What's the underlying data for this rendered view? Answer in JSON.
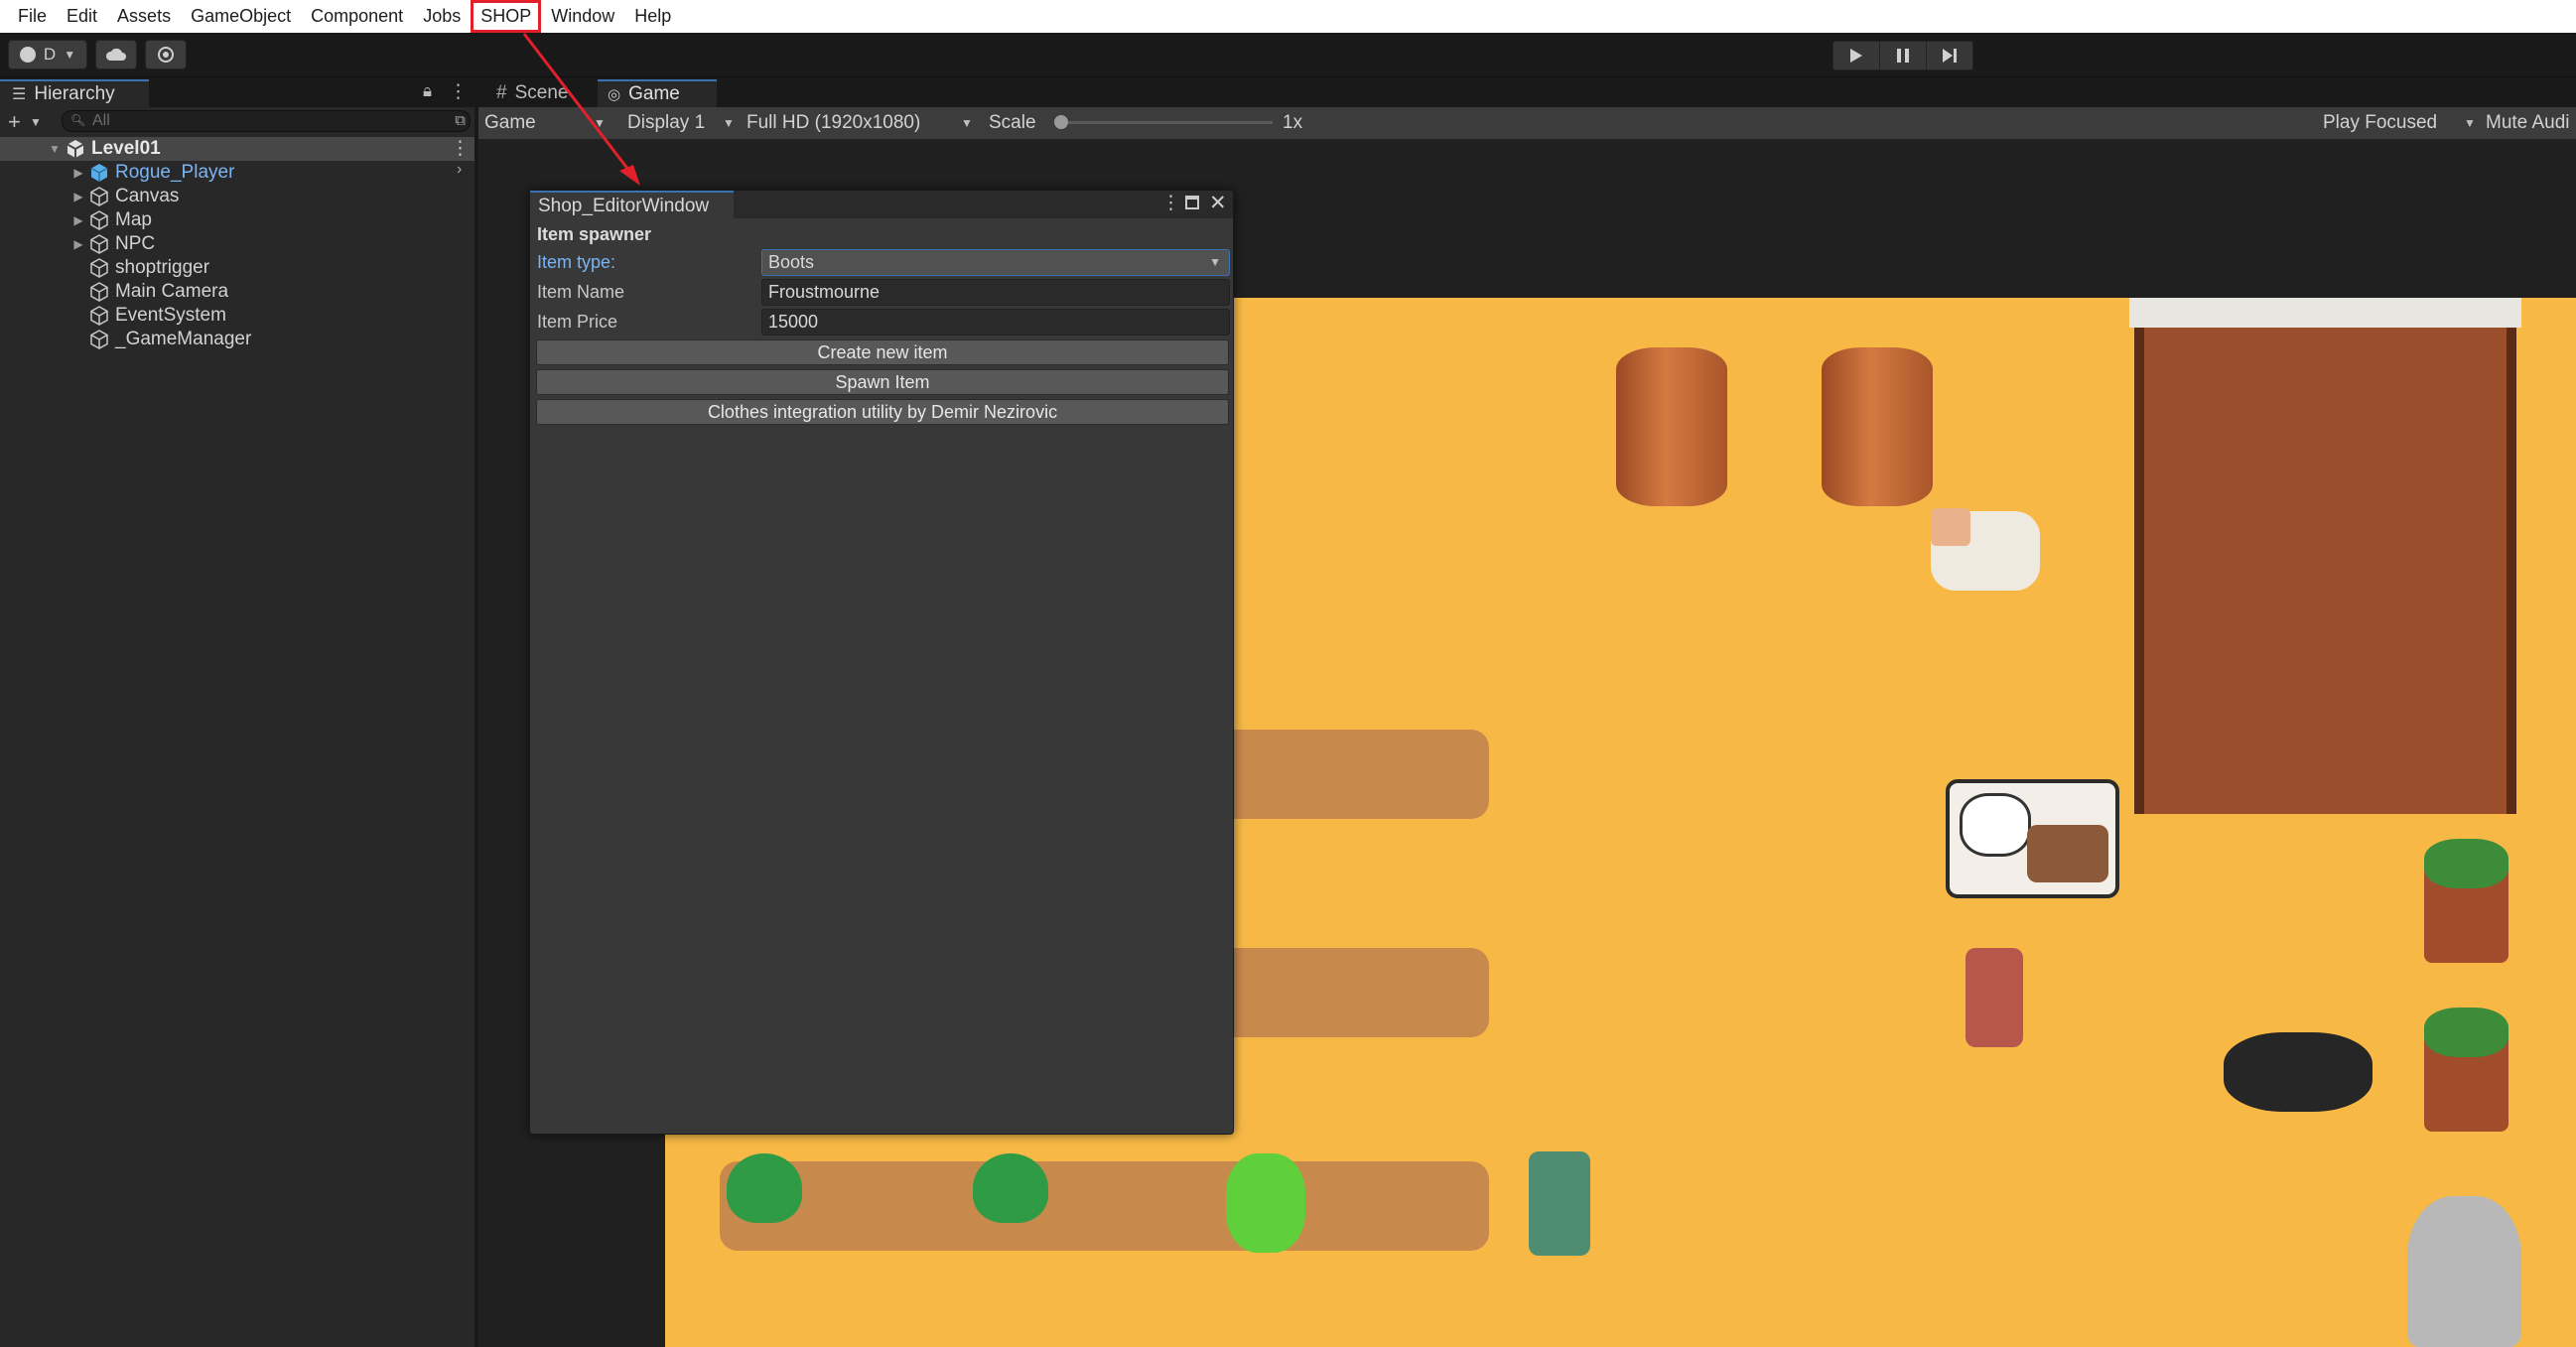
{
  "menubar": {
    "items": [
      "File",
      "Edit",
      "Assets",
      "GameObject",
      "Component",
      "Jobs",
      "SHOP",
      "Window",
      "Help"
    ],
    "highlighted": "SHOP",
    "highlight_color": "#e2202c"
  },
  "toolbar": {
    "account_label": "D",
    "icons": [
      "account-icon",
      "cloud-icon",
      "collab-icon",
      "play-icon",
      "pause-icon",
      "step-icon"
    ]
  },
  "hierarchy": {
    "tab_label": "Hierarchy",
    "search_placeholder": "All",
    "scene_name": "Level01",
    "objects": [
      {
        "name": "Rogue_Player",
        "expandable": true,
        "prefab": true
      },
      {
        "name": "Canvas",
        "expandable": true,
        "prefab": false
      },
      {
        "name": "Map",
        "expandable": true,
        "prefab": false
      },
      {
        "name": "NPC",
        "expandable": true,
        "prefab": false
      },
      {
        "name": "shoptrigger",
        "expandable": false,
        "prefab": false
      },
      {
        "name": "Main Camera",
        "expandable": false,
        "prefab": false
      },
      {
        "name": "EventSystem",
        "expandable": false,
        "prefab": false
      },
      {
        "name": "_GameManager",
        "expandable": false,
        "prefab": false
      }
    ]
  },
  "gameview": {
    "tabs": [
      "Scene",
      "Game"
    ],
    "active_tab": "Game",
    "view_mode": "Game",
    "display": "Display 1",
    "resolution": "Full HD (1920x1080)",
    "scale_label": "Scale",
    "scale_value": "1x",
    "play_focused": "Play Focused",
    "mute": "Mute Audi"
  },
  "shop_window": {
    "title": "Shop_EditorWindow",
    "section_title": "Item spawner",
    "item_type_label": "Item type:",
    "item_type_value": "Boots",
    "item_name_label": "Item Name",
    "item_name_value": "Froustmourne",
    "item_price_label": "Item Price",
    "item_price_value": "15000",
    "buttons": [
      "Create new item",
      "Spawn Item",
      "Clothes integration utility by Demir Nezirovic"
    ]
  },
  "colors": {
    "accent_blue": "#3a72b0",
    "label_blue": "#7ab4f5",
    "sand": "#f7b846",
    "soil": "#c7894c"
  }
}
